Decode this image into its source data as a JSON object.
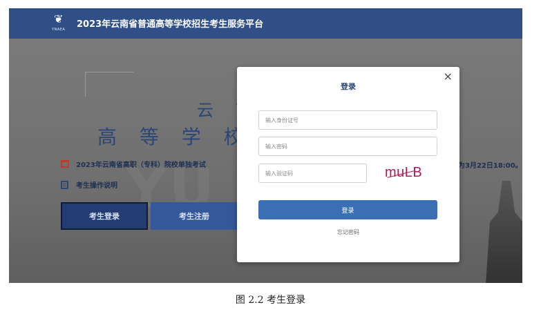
{
  "header": {
    "logo_icon": "yunnan-exam-logo",
    "logo_text": "YNAEA",
    "title": "2023年云南省普通高等学校招生考生服务平台"
  },
  "hero": {
    "line1": "云 南",
    "line2": "高 等 学 校 招"
  },
  "notice": {
    "icon": "calendar-icon",
    "text": "2023年云南省高职（专科）院校单独考试",
    "right_text": "间为3月22日18:00。"
  },
  "guide": {
    "icon": "document-icon",
    "text": "考生操作说明"
  },
  "background_buttons": {
    "login_label": "考生登录",
    "register_label": "考生注册"
  },
  "modal": {
    "title": "登录",
    "close": "×",
    "id_placeholder": "输入身份证号",
    "password_placeholder": "输入密码",
    "captcha_placeholder": "输入验证码",
    "captcha_text": "muLB",
    "submit_label": "登录",
    "forgot_label": "忘记密码"
  },
  "caption": "图 2.2  考生登录",
  "colors": {
    "header_bg": "#2f4f86",
    "primary_button": "#3a6fb3",
    "captcha": "#b0185a"
  }
}
